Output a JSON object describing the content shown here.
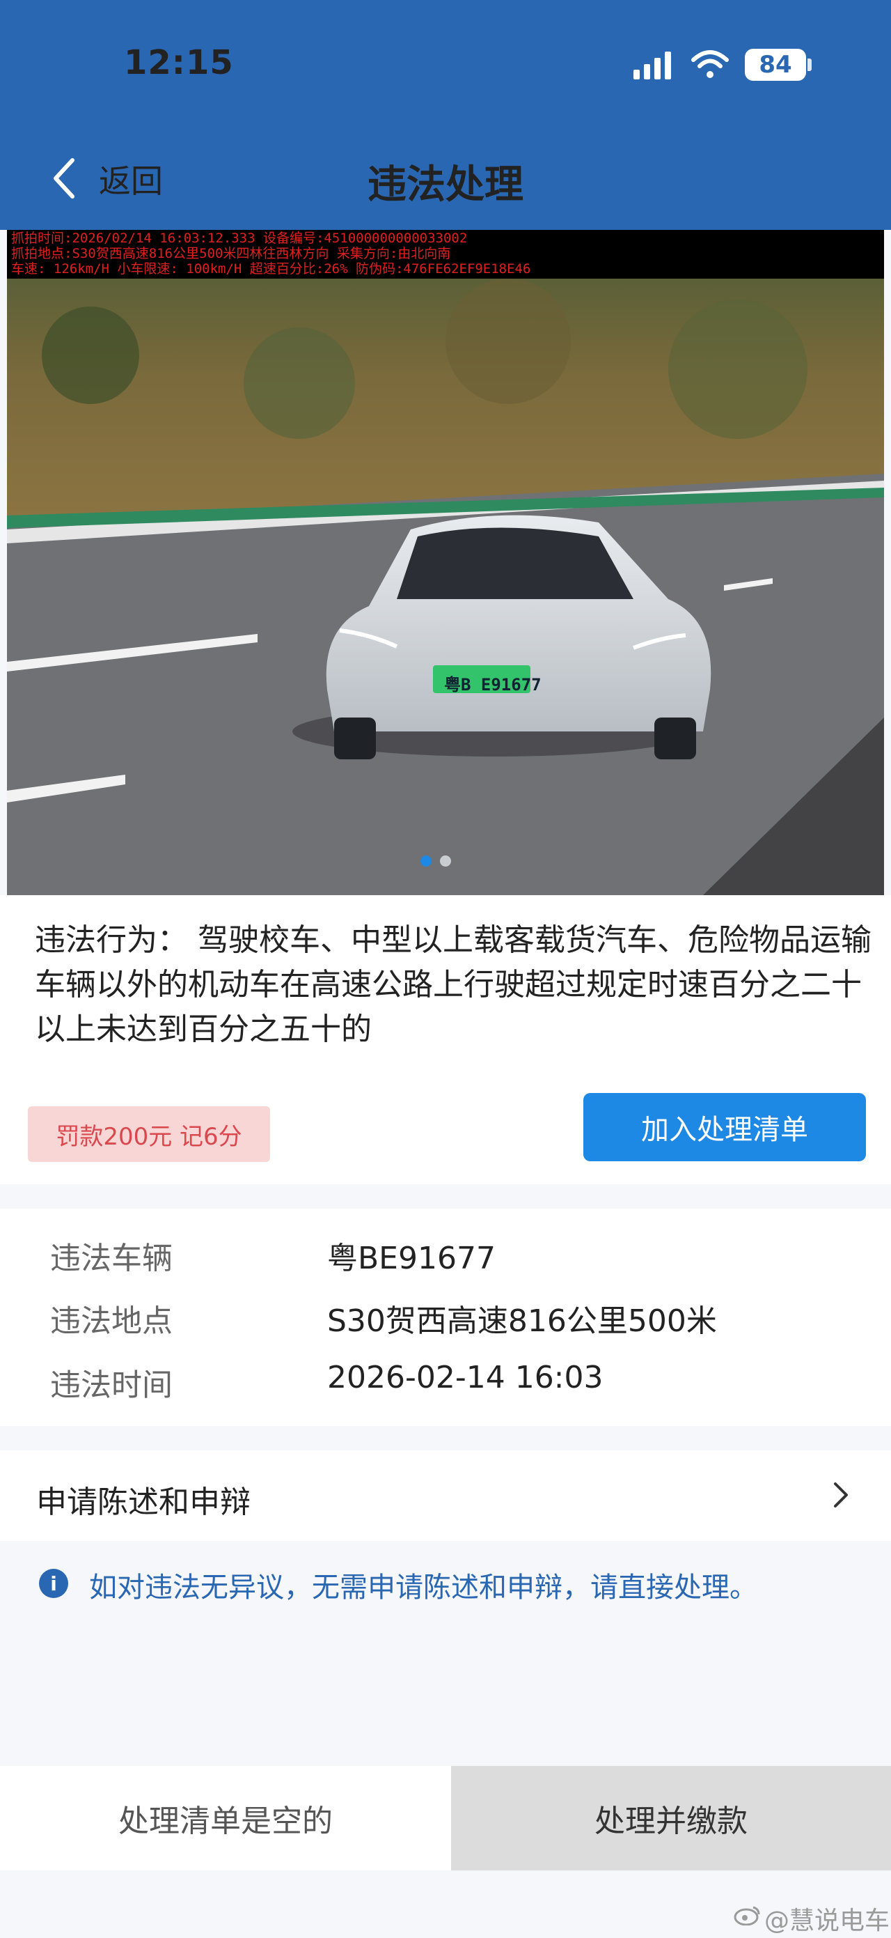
{
  "status_bar": {
    "time": "12:15",
    "battery": "84"
  },
  "header": {
    "back_label": "返回",
    "title": "违法处理"
  },
  "photo": {
    "overlay_lines": [
      "抓拍时间:2026/02/14 16:03:12.333 设备编号:451000000000033002",
      "抓拍地点:S30贺西高速816公里500米四林往西林方向 采集方向:由北向南",
      "车速: 126km/H 小车限速: 100km/H 超速百分比:26% 防伪码:476FE62EF9E18E46"
    ],
    "plate": "粤B E91677",
    "dots": {
      "count": 2,
      "active": 0
    }
  },
  "violation": {
    "text": "违法行为：  驾驶校车、中型以上载客载货汽车、危险物品运输车辆以外的机动车在高速公路上行驶超过规定时速百分之二十以上未达到百分之五十的",
    "fine": "罚款200元 记6分",
    "add_button": "加入处理清单"
  },
  "details": {
    "vehicle_label": "违法车辆",
    "vehicle_value": "粤BE91677",
    "location_label": "违法地点",
    "location_value": "S30贺西高速816公里500米",
    "time_label": "违法时间",
    "time_value": "2026-02-14 16:03"
  },
  "appeal": {
    "label": "申请陈述和申辩"
  },
  "info": {
    "icon": "i",
    "text": "如对违法无异议，无需申请陈述和申辩，请直接处理。"
  },
  "bottom": {
    "list_status": "处理清单是空的",
    "pay_button": "处理并缴款"
  },
  "watermark": "@慧说电车",
  "colors": {
    "header": "#2a67b3",
    "accent": "#1e88e5",
    "fine_bg": "#f9d6d6",
    "fine_text": "#d9484d"
  }
}
